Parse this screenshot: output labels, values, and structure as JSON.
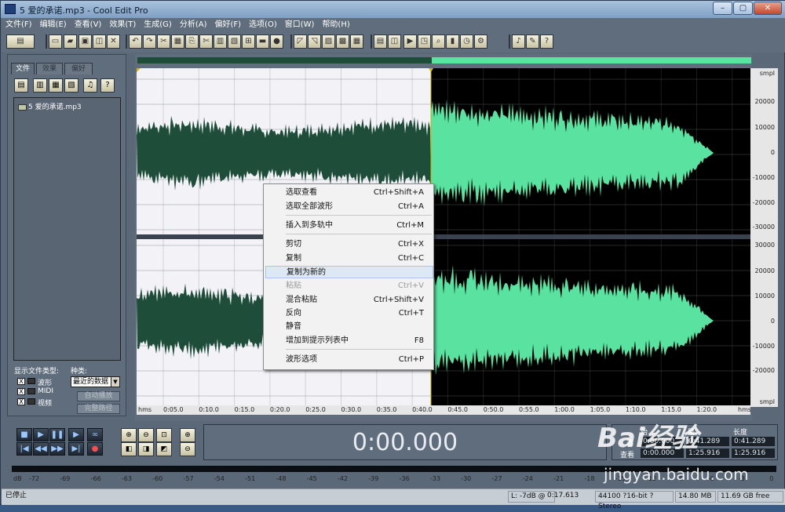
{
  "window": {
    "title": "5 爱的承诺.mp3 - Cool Edit Pro",
    "min": "–",
    "max": "▢",
    "close": "✕"
  },
  "menu": [
    "文件(F)",
    "编辑(E)",
    "查看(V)",
    "效果(T)",
    "生成(G)",
    "分析(A)",
    "偏好(F)",
    "选项(O)",
    "窗口(W)",
    "帮助(H)"
  ],
  "left": {
    "tabs": [
      "文件",
      "效果",
      "偏好"
    ],
    "file": "5 爱的承诺.mp3",
    "showtype_label": "显示文件类型:",
    "sort_label": "种类:",
    "types": [
      "波形",
      "MIDI",
      "视频"
    ],
    "check": "X",
    "sort_value": "最近的数据",
    "auto_play": "自动播放",
    "full_path": "完整路径"
  },
  "ruler": {
    "labels": [
      "hms",
      "0:05.0",
      "0:10.0",
      "0:15.0",
      "0:20.0",
      "0:25.0",
      "0:30.0",
      "0:35.0",
      "0:40.0",
      "0:45.0",
      "0:50.0",
      "0:55.0",
      "1:00.0",
      "1:05.0",
      "1:10.0",
      "1:15.0",
      "1:20.0",
      "hms"
    ]
  },
  "scale": {
    "labels": [
      "smpl",
      "20000",
      "10000",
      "0",
      "-10000",
      "-20000",
      "-30000",
      "30000",
      "20000",
      "10000",
      "0",
      "-10000",
      "-20000",
      "smpl"
    ]
  },
  "context_menu": [
    {
      "label": "选取查看",
      "key": "Ctrl+Shift+A"
    },
    {
      "label": "选取全部波形",
      "key": "Ctrl+A"
    },
    {
      "label": "插入到多轨中",
      "key": "Ctrl+M"
    },
    {
      "label": "剪切",
      "key": "Ctrl+X"
    },
    {
      "label": "复制",
      "key": "Ctrl+C"
    },
    {
      "label": "复制为新的",
      "key": ""
    },
    {
      "label": "粘贴",
      "key": "Ctrl+V"
    },
    {
      "label": "混合粘贴",
      "key": "Ctrl+Shift+V"
    },
    {
      "label": "反向",
      "key": "Ctrl+T"
    },
    {
      "label": "静音",
      "key": ""
    },
    {
      "label": "增加到提示列表中",
      "key": "F8"
    },
    {
      "label": "波形选项",
      "key": "Ctrl+P"
    }
  ],
  "time_display": "0:00.000",
  "selection": {
    "headers": [
      "始",
      "尾",
      "长度"
    ],
    "rows": [
      "选",
      "查看"
    ],
    "sel_begin": "0:00.000",
    "sel_end": "0:41.289",
    "sel_len": "0:41.289",
    "view_begin": "0:00.000",
    "view_end": "1:25.916",
    "view_len": "1:25.916"
  },
  "meter": {
    "labels": [
      "dB",
      "-72",
      "-69",
      "-66",
      "-63",
      "-60",
      "-57",
      "-54",
      "-51",
      "-48",
      "-45",
      "-42",
      "-39",
      "-36",
      "-33",
      "-30",
      "-27",
      "-24",
      "-21",
      "-18",
      "-15",
      "-12",
      "-9",
      "-6",
      "-3",
      "0"
    ]
  },
  "status": {
    "state": "已停止",
    "level": "L: -7dB @",
    "pos": "0:17.613",
    "format": "44100 ?16-bit ?Stereo",
    "size": "14.80 MB",
    "free": "11.69 GB free"
  },
  "watermark": {
    "logo": "Bai经验",
    "url": "jingyan.baidu.com"
  },
  "colors": {
    "wave_selected": "#1e4d3a",
    "wave_unselected": "#5ae3a0",
    "bg_selected": "#f3f3f7",
    "bg_unselected": "#000000"
  }
}
